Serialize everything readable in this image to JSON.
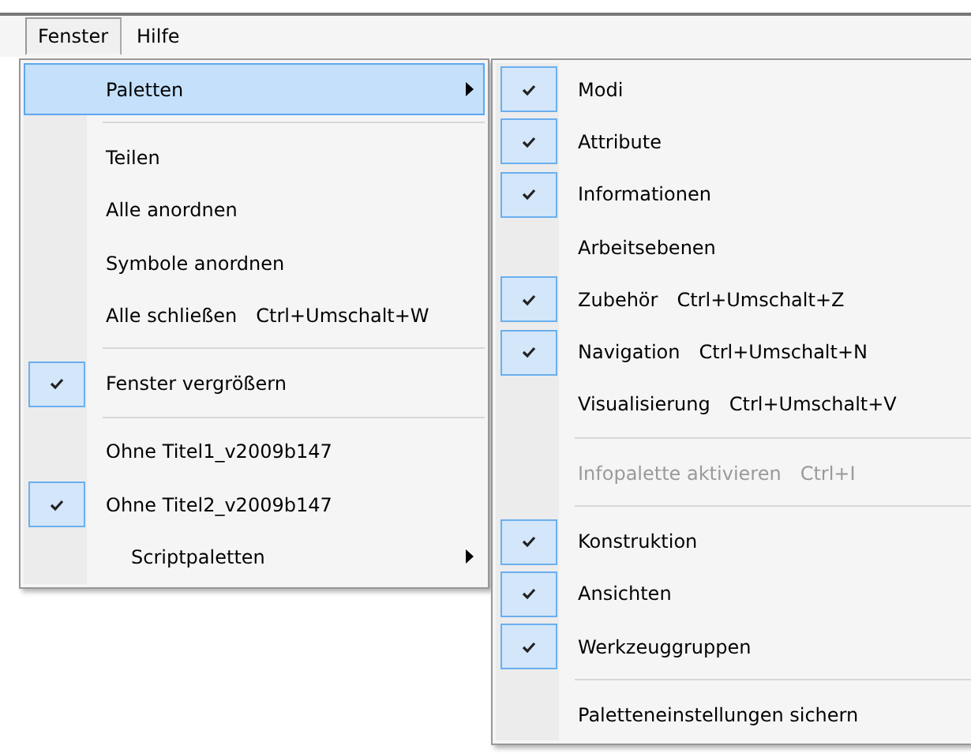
{
  "menubar": [
    {
      "label": "Fenster",
      "selected": true
    },
    {
      "label": "Hilfe",
      "selected": false
    }
  ],
  "menu": [
    {
      "kind": "item",
      "label": "Paletten",
      "selected": true,
      "submenu": true
    },
    {
      "kind": "separator"
    },
    {
      "kind": "item",
      "label": "Teilen"
    },
    {
      "kind": "item",
      "label": "Alle anordnen"
    },
    {
      "kind": "item",
      "label": "Symbole anordnen"
    },
    {
      "kind": "item",
      "label": "Alle schließen",
      "shortcut": "Ctrl+Umschalt+W"
    },
    {
      "kind": "separator"
    },
    {
      "kind": "item",
      "label": "Fenster vergrößern",
      "checked": true
    },
    {
      "kind": "separator"
    },
    {
      "kind": "item",
      "label": "Ohne Titel1_v2009b147",
      "checked": false
    },
    {
      "kind": "item",
      "label": "Ohne Titel2_v2009b147",
      "checked": true
    },
    {
      "kind": "indented",
      "label": "Scriptpaletten",
      "submenu": true
    }
  ],
  "submenu": [
    {
      "kind": "item",
      "label": "Modi",
      "checked": true
    },
    {
      "kind": "item",
      "label": "Attribute",
      "checked": true
    },
    {
      "kind": "item",
      "label": "Informationen",
      "checked": true
    },
    {
      "kind": "item",
      "label": "Arbeitsebenen",
      "checked": false
    },
    {
      "kind": "item",
      "label": "Zubehör",
      "checked": true,
      "shortcut": "Ctrl+Umschalt+Z"
    },
    {
      "kind": "item",
      "label": "Navigation",
      "checked": true,
      "shortcut": "Ctrl+Umschalt+N"
    },
    {
      "kind": "item",
      "label": "Visualisierung",
      "checked": false,
      "shortcut": "Ctrl+Umschalt+V"
    },
    {
      "kind": "separator"
    },
    {
      "kind": "item",
      "label": "Infopalette aktivieren",
      "disabled": true,
      "shortcut": "Ctrl+I"
    },
    {
      "kind": "separator"
    },
    {
      "kind": "item",
      "label": "Konstruktion",
      "checked": true
    },
    {
      "kind": "item",
      "label": "Ansichten",
      "checked": true
    },
    {
      "kind": "item",
      "label": "Werkzeuggruppen",
      "checked": true
    },
    {
      "kind": "separator"
    },
    {
      "kind": "item",
      "label": "Paletteneinstellungen sichern"
    }
  ]
}
